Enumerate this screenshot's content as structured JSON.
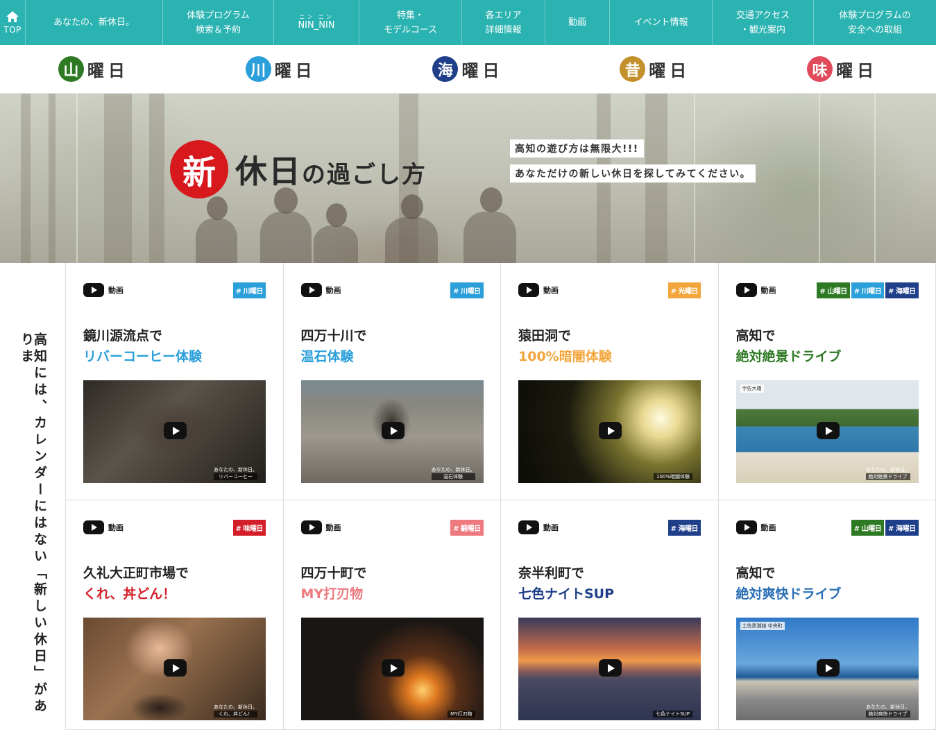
{
  "nav": {
    "home_label": "TOP",
    "items": [
      {
        "label": "あなたの、新休日。"
      },
      {
        "label": "体験プログラム\n検索＆予約"
      },
      {
        "ruby": "ニン ニン",
        "label": "NIN_NIN"
      },
      {
        "label": "特集・\nモデルコース"
      },
      {
        "label": "各エリア\n詳細情報"
      },
      {
        "label": "動画"
      },
      {
        "label": "イベント情報"
      },
      {
        "label": "交通アクセス\n・観光案内"
      },
      {
        "label": "体験プログラムの\n安全への取組"
      }
    ]
  },
  "days": [
    {
      "kanji": "山",
      "suffix": "曜日",
      "color": "#2e7a24"
    },
    {
      "kanji": "川",
      "suffix": "曜日",
      "color": "#2a9fd9"
    },
    {
      "kanji": "海",
      "suffix": "曜日",
      "color": "#1f3f8a"
    },
    {
      "kanji": "昔",
      "suffix": "曜日",
      "color": "#c4902b"
    },
    {
      "kanji": "味",
      "suffix": "曜日",
      "color": "#e04a5a"
    }
  ],
  "hero": {
    "badge": "新",
    "title_a": "休日",
    "title_b": "の過ごし方",
    "sub1": "高知の遊び方は無限大!!!",
    "sub2": "あなただけの新しい休日を探してみてください。"
  },
  "side_text": "高知には、カレンダーにはない「新しい休日」がありま",
  "colors": {
    "mountain": "#2e7a24",
    "river": "#2a9fd9",
    "sea": "#1f3f8a",
    "light": "#f2a53a",
    "taste": "#d31f2a",
    "blade": "#ee7a80",
    "teal": "#2bb3b1"
  },
  "cards": [
    {
      "video_label": "動画",
      "tags": [
        {
          "text": "# 川曜日",
          "color": "#2a9fd9"
        }
      ],
      "line1": "鏡川源流点で",
      "line2": "リバーコーヒー体験",
      "line2_color": "#2a9fd9",
      "thumb_brand": "あなたの、新休日。",
      "thumb_caption": "リバーコーヒー",
      "thumb_bg": "radial-gradient(ellipse 90px 60px at 130px 70px, #4a3e36, transparent 70%), linear-gradient(135deg, #2e2a24 0%, #5a544a 40%, #231f1b 100%)"
    },
    {
      "video_label": "動画",
      "tags": [
        {
          "text": "# 川曜日",
          "color": "#2a9fd9"
        }
      ],
      "line1": "四万十川で",
      "line2": "温石体験",
      "line2_color": "#2a9fd9",
      "thumb_brand": "あなたの、新休日。",
      "thumb_caption": "温石体験",
      "thumb_bg": "radial-gradient(ellipse 40px 50px at 130px 60px, #3a3630, transparent 70%), linear-gradient(180deg, #7a8a92 0%, #8a8880 25%, #9c9890 55%, #6e6a62 100%)"
    },
    {
      "video_label": "動画",
      "tags": [
        {
          "text": "# 光曜日",
          "color": "#f2a53a"
        }
      ],
      "line1": "猿田洞で",
      "line2": "100%暗闇体験",
      "line2_color": "#f2a53a",
      "thumb_brand": "",
      "thumb_caption": "100%暗闇体験",
      "thumb_bg": "radial-gradient(circle at 205px 55px, #fffbe0 0%, #e8d890 12%, #7a7430 30%, #1a1a0e 60%, #0c0c08 100%)"
    },
    {
      "video_label": "動画",
      "tags": [
        {
          "text": "# 山曜日",
          "color": "#2e7a24"
        },
        {
          "text": "# 川曜日",
          "color": "#2a9fd9"
        },
        {
          "text": "# 海曜日",
          "color": "#1f3f8a"
        }
      ],
      "line1": "高知で",
      "line2": "絶対絶景ドライブ",
      "line2_color": "#2e7a24",
      "thumb_brand": "あなたの、新休日。",
      "thumb_caption": "絶対絶景ドライブ",
      "thumb_sign": "宇佐大橋",
      "thumb_bg": "linear-gradient(180deg, #dfe6ec 0%, #dfe6ec 28%, #4f7a3e 28%, #3f6a30 45%, #3b86b4 45%, #2f78aa 70%, #e6dfcf 70%, #d8cfb8 100%)"
    },
    {
      "video_label": "動画",
      "tags": [
        {
          "text": "# 味曜日",
          "color": "#d31f2a"
        }
      ],
      "line1": "久礼大正町市場で",
      "line2": "くれ、丼どん！",
      "line2_color": "#d31f2a",
      "thumb_brand": "あなたの、新休日。",
      "thumb_caption": "くれ、丼どん！",
      "thumb_bg": "radial-gradient(ellipse 70px 60px at 110px 45px, #e8b898, transparent 70%), radial-gradient(ellipse 60px 30px at 110px 130px, #2a1f18, transparent 70%), linear-gradient(135deg, #6a4a32 0%, #9a7250 40%, #3a2a1e 100%)"
    },
    {
      "video_label": "動画",
      "tags": [
        {
          "text": "# 鍛曜日",
          "color": "#ee7a80"
        }
      ],
      "line1": "四万十町で",
      "line2": "MY打刃物",
      "line2_color": "#ee7a80",
      "thumb_brand": "",
      "thumb_caption": "MY打刃物",
      "thumb_bg": "radial-gradient(circle at 175px 105px, #ffd070 0%, #e07a20 10%, #5a3018 25%, #1a1614 50%), linear-gradient(180deg, #2a2826, #141210)"
    },
    {
      "video_label": "動画",
      "tags": [
        {
          "text": "# 海曜日",
          "color": "#1f3f8a"
        }
      ],
      "line1": "奈半利町で",
      "line2": "七色ナイトSUP",
      "line2_color": "#1f3f8a",
      "thumb_brand": "",
      "thumb_caption": "七色ナイトSUP",
      "thumb_bg": "linear-gradient(180deg, #3a3a5a 0%, #c06a4a 30%, #f09a4a 42%, #8a5a5a 52%, #4a4a62 60%, #2e3450 100%)"
    },
    {
      "video_label": "動画",
      "tags": [
        {
          "text": "# 山曜日",
          "color": "#2e7a24"
        },
        {
          "text": "# 海曜日",
          "color": "#1f3f8a"
        }
      ],
      "line1": "高知で",
      "line2": "絶対爽快ドライブ",
      "line2_color": "#2a6fb4",
      "thumb_brand": "あなたの、新休日。",
      "thumb_caption": "絶対爽快ドライブ",
      "thumb_sign": "土佐黒潮線 中央町",
      "thumb_bg": "linear-gradient(180deg, #2f7ac8 0%, #6aa6dc 45%, #1f5c96 58%, #c9c4b8 62%, #8a8a8a 80%, #6e6e6e 100%)"
    }
  ]
}
